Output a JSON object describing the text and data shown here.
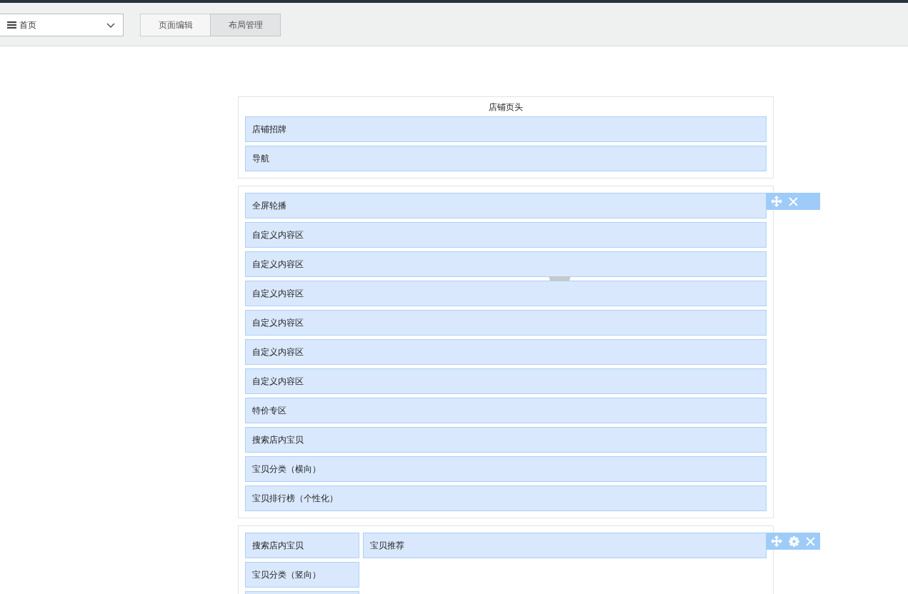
{
  "header": {
    "page_select": {
      "value": "首页"
    },
    "tabs": [
      {
        "label": "页面编辑",
        "selected": false
      },
      {
        "label": "布局管理",
        "selected": true
      }
    ]
  },
  "sections": [
    {
      "title": "店铺页头",
      "columns": [
        {
          "kind": "full",
          "blocks": [
            {
              "label": "店铺招牌"
            },
            {
              "label": "导航"
            }
          ]
        }
      ]
    },
    {
      "columns": [
        {
          "kind": "full",
          "blocks": [
            {
              "label": "全屏轮播",
              "toolbar": [
                {
                  "kind": "move"
                },
                {
                  "kind": "close"
                }
              ]
            },
            {
              "label": "自定义内容区"
            },
            {
              "label": "自定义内容区",
              "handle": true
            },
            {
              "label": "自定义内容区"
            },
            {
              "label": "自定义内容区"
            },
            {
              "label": "自定义内容区"
            },
            {
              "label": "自定义内容区"
            },
            {
              "label": "特价专区"
            },
            {
              "label": "搜索店内宝贝"
            },
            {
              "label": "宝贝分类（横向）"
            },
            {
              "label": "宝贝排行榜（个性化）"
            }
          ]
        }
      ]
    },
    {
      "columns": [
        {
          "kind": "side",
          "blocks": [
            {
              "label": "搜索店内宝贝"
            },
            {
              "label": "宝贝分类（竖向）"
            }
          ],
          "cut_off_block": true
        },
        {
          "kind": "main",
          "blocks": [
            {
              "label": "宝贝推荐",
              "toolbar": [
                {
                  "kind": "move"
                },
                {
                  "kind": "settings"
                },
                {
                  "kind": "close"
                }
              ]
            }
          ]
        }
      ]
    }
  ]
}
